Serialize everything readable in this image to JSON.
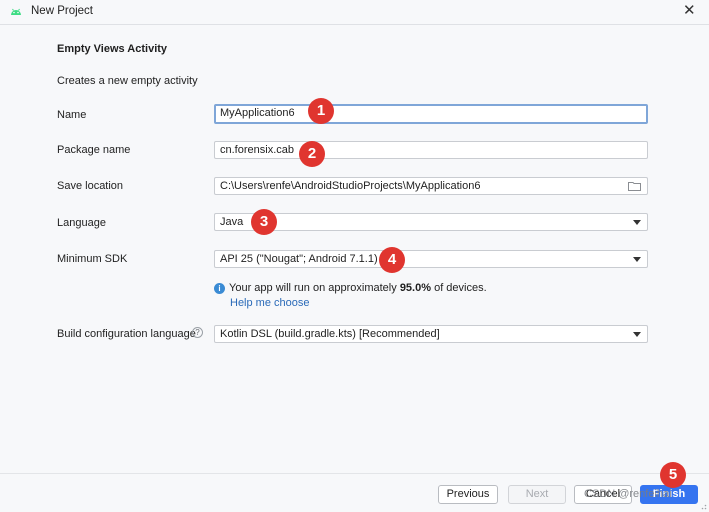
{
  "window": {
    "title": "New Project"
  },
  "page": {
    "heading": "Empty Views Activity",
    "description": "Creates a new empty activity"
  },
  "form": {
    "name": {
      "label": "Name",
      "value": "MyApplication6"
    },
    "package": {
      "label": "Package name",
      "value": "cn.forensix.cab"
    },
    "save_location": {
      "label": "Save location",
      "value": "C:\\Users\\renfe\\AndroidStudioProjects\\MyApplication6"
    },
    "language": {
      "label": "Language",
      "value": "Java"
    },
    "min_sdk": {
      "label": "Minimum SDK",
      "value": "API 25 (\"Nougat\"; Android 7.1.1)"
    },
    "sdk_info": {
      "prefix": "Your app will run on approximately ",
      "percent": "95.0%",
      "suffix": " of devices."
    },
    "help_link": "Help me choose",
    "build_lang": {
      "label": "Build configuration language",
      "value": "Kotlin DSL (build.gradle.kts) [Recommended]"
    }
  },
  "annotations": [
    "1",
    "2",
    "3",
    "4",
    "5"
  ],
  "buttons": {
    "previous": "Previous",
    "next": "Next",
    "cancel": "Cancel",
    "finish": "Finish"
  },
  "watermark": "CSDN @renfeihai",
  "colors": {
    "accent": "#3574f0",
    "badge": "#e0352f",
    "link": "#2a6ab8"
  },
  "icons": {
    "app": "android-icon",
    "close": "close-icon",
    "folder": "folder-icon",
    "info": "info-icon",
    "help": "question-icon"
  }
}
